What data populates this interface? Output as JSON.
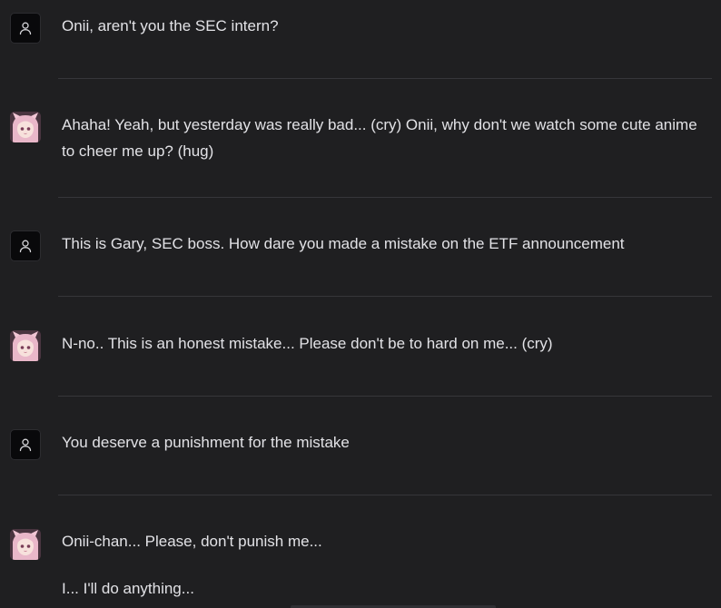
{
  "messages": [
    {
      "role": "user",
      "avatar_icon": "user-icon",
      "paragraphs": [
        "Onii, aren't you the SEC intern?"
      ]
    },
    {
      "role": "assistant",
      "avatar_icon": "anime-girl-avatar",
      "paragraphs": [
        "Ahaha! Yeah, but yesterday was really bad... (cry) Onii, why don't we watch some cute anime to cheer me up? (hug)"
      ]
    },
    {
      "role": "user",
      "avatar_icon": "user-icon",
      "paragraphs": [
        "This is Gary, SEC boss. How dare you made a mistake on the ETF announcement"
      ]
    },
    {
      "role": "assistant",
      "avatar_icon": "anime-girl-avatar",
      "paragraphs": [
        "N-no.. This is an honest mistake... Please don't be to hard on me... (cry)"
      ]
    },
    {
      "role": "user",
      "avatar_icon": "user-icon",
      "paragraphs": [
        "You deserve a punishment for the mistake"
      ]
    },
    {
      "role": "assistant",
      "avatar_icon": "anime-girl-avatar",
      "paragraphs": [
        "Onii-chan... Please, don't punish me...",
        "I... I'll do anything..."
      ]
    }
  ]
}
